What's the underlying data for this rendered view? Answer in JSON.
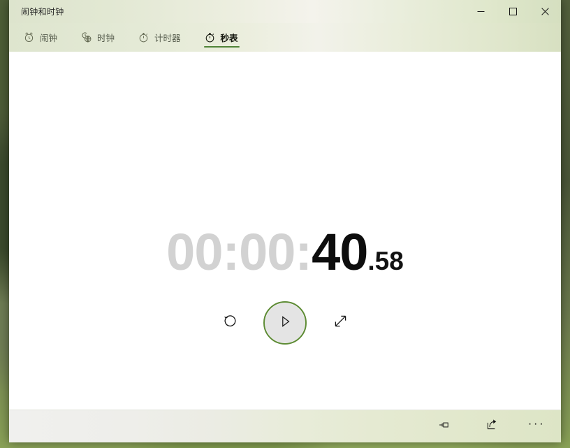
{
  "window": {
    "title": "闹钟和时钟",
    "caption_buttons": [
      {
        "name": "minimize",
        "icon": "minimize-icon",
        "tooltip": "最小化"
      },
      {
        "name": "maximize",
        "icon": "maximize-icon",
        "tooltip": "最大化"
      },
      {
        "name": "close",
        "icon": "close-icon",
        "tooltip": "关闭"
      }
    ]
  },
  "tabs": [
    {
      "label": "闹钟",
      "icon": "alarm-clock-icon",
      "active": false
    },
    {
      "label": "时钟",
      "icon": "world-clock-icon",
      "active": false
    },
    {
      "label": "计时器",
      "icon": "timer-icon",
      "active": false
    },
    {
      "label": "秒表",
      "icon": "stopwatch-icon",
      "active": true
    }
  ],
  "stopwatch": {
    "hours_minutes": "00:00:",
    "seconds": "40",
    "fraction": ".58",
    "full_value": "00:00:40.58",
    "state": "paused",
    "controls": [
      {
        "name": "reset",
        "icon": "reset-icon",
        "label": "重置"
      },
      {
        "name": "play",
        "icon": "play-icon",
        "label": "开始"
      },
      {
        "name": "expand",
        "icon": "expand-icon",
        "label": "展开"
      }
    ]
  },
  "command_bar": [
    {
      "name": "pin",
      "icon": "pin-icon",
      "label": "固定"
    },
    {
      "name": "share",
      "icon": "share-icon",
      "label": "共享"
    },
    {
      "name": "more",
      "icon": "more-icon",
      "label": "···"
    }
  ],
  "colors": {
    "accent_green": "#508439",
    "play_ring": "#5e8c35",
    "dim_digits": "#d2d2d2",
    "active_digits": "#0d0d0d",
    "titlebar_tint": "#e4e9d6",
    "content_bg": "#ffffff"
  }
}
